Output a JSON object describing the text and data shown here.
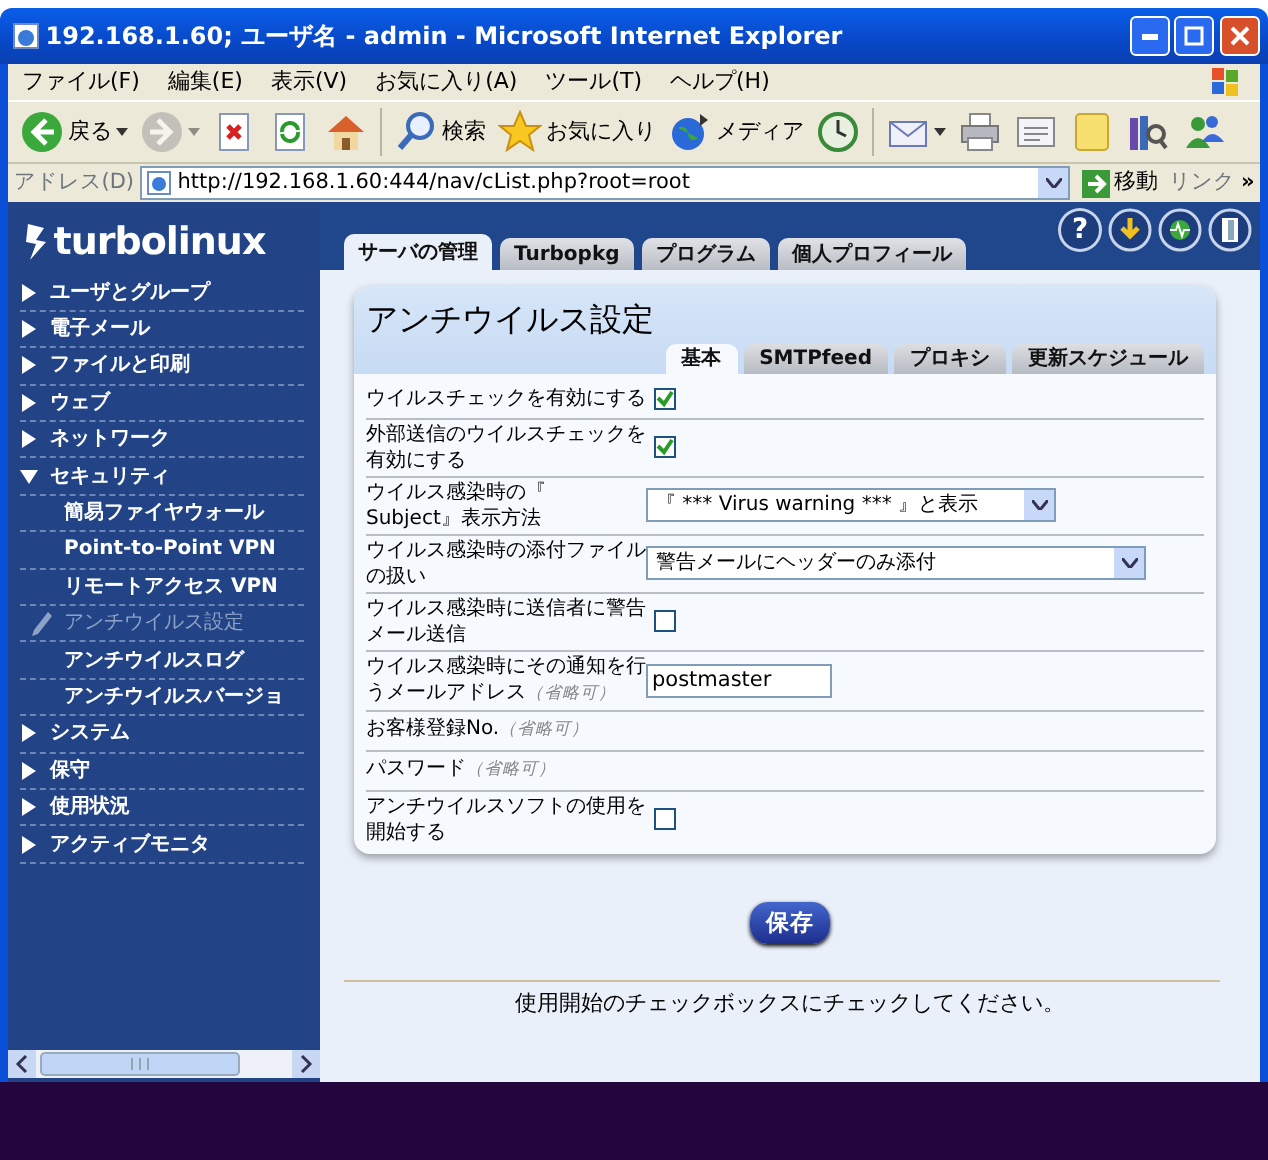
{
  "window": {
    "title": "192.168.1.60; ユーザ名 - admin - Microsoft Internet Explorer"
  },
  "menu_bar": [
    "ファイル(F)",
    "編集(E)",
    "表示(V)",
    "お気に入り(A)",
    "ツール(T)",
    "ヘルプ(H)"
  ],
  "toolbar": [
    {
      "kind": "back",
      "label": "戻る",
      "dropdown": true,
      "disabled": false
    },
    {
      "kind": "forward",
      "dropdown": true,
      "disabled": true
    },
    {
      "kind": "stop",
      "disabled": false
    },
    {
      "kind": "refresh",
      "disabled": false
    },
    {
      "kind": "home",
      "disabled": false
    },
    {
      "kind": "separator"
    },
    {
      "kind": "search",
      "label": "検索",
      "disabled": false
    },
    {
      "kind": "favorites",
      "label": "お気に入り",
      "disabled": false
    },
    {
      "kind": "media",
      "label": "メディア",
      "disabled": false
    },
    {
      "kind": "history",
      "disabled": false
    },
    {
      "kind": "separator"
    },
    {
      "kind": "mail",
      "dropdown": true,
      "disabled": false
    },
    {
      "kind": "print",
      "disabled": false
    },
    {
      "kind": "edit",
      "disabled": false
    },
    {
      "kind": "note",
      "disabled": false
    },
    {
      "kind": "research",
      "disabled": false
    },
    {
      "kind": "messenger",
      "disabled": false
    }
  ],
  "address_bar": {
    "label": "アドレス(D)",
    "url": "http://192.168.1.60:444/nav/cList.php?root=root",
    "go": "移動",
    "links": "リンク",
    "more": "»"
  },
  "sidebar": {
    "logo": "turbolinux",
    "items": [
      {
        "label": "ユーザとグループ",
        "expanded": false
      },
      {
        "label": "電子メール",
        "expanded": false
      },
      {
        "label": "ファイルと印刷",
        "expanded": false
      },
      {
        "label": "ウェブ",
        "expanded": false
      },
      {
        "label": "ネットワーク",
        "expanded": false
      },
      {
        "label": "セキュリティ",
        "expanded": true,
        "children": [
          {
            "label": "簡易ファイヤウォール",
            "selected": false
          },
          {
            "label": "Point-to-Point VPN",
            "selected": false
          },
          {
            "label": "リモートアクセス VPN",
            "selected": false
          },
          {
            "label": "アンチウイルス設定",
            "selected": true
          },
          {
            "label": "アンチウイルスログ",
            "selected": false
          },
          {
            "label": "アンチウイルスバージョ",
            "selected": false
          }
        ]
      },
      {
        "label": "システム",
        "expanded": false
      },
      {
        "label": "保守",
        "expanded": false
      },
      {
        "label": "使用状況",
        "expanded": false
      },
      {
        "label": "アクティブモニタ",
        "expanded": false
      }
    ]
  },
  "top_tabs": [
    {
      "label": "サーバの管理",
      "selected": true
    },
    {
      "label": "Turbopkg",
      "selected": false
    },
    {
      "label": "プログラム",
      "selected": false
    },
    {
      "label": "個人プロフィール",
      "selected": false
    }
  ],
  "top_icons": [
    {
      "kind": "help",
      "glyph": "?"
    },
    {
      "kind": "download"
    },
    {
      "kind": "monitor"
    },
    {
      "kind": "logout"
    }
  ],
  "panel": {
    "title": "アンチウイルス設定",
    "tabs": [
      {
        "label": "基本",
        "selected": true
      },
      {
        "label": "SMTPfeed",
        "selected": false
      },
      {
        "label": "プロキシ",
        "selected": false
      },
      {
        "label": "更新スケジュール",
        "selected": false
      }
    ],
    "rows": [
      {
        "kind": "checkbox",
        "label": "ウイルスチェックを有効にする",
        "checked": true
      },
      {
        "kind": "checkbox",
        "label": "外部送信のウイルスチェックを有効にする",
        "checked": true
      },
      {
        "kind": "select",
        "label": "ウイルス感染時の『 Subject』表示方法",
        "value": "『 *** Virus warning *** 』と表示",
        "wide": false
      },
      {
        "kind": "select",
        "label": "ウイルス感染時の添付ファイルの扱い",
        "value": "警告メールにヘッダーのみ添付",
        "wide": true
      },
      {
        "kind": "checkbox",
        "label": "ウイルス感染時に送信者に警告メール送信",
        "checked": false
      },
      {
        "kind": "text",
        "label": "ウイルス感染時にその通知を行うメールアドレス",
        "hint": "（省略可）",
        "value": "postmaster"
      },
      {
        "kind": "plain",
        "label": "お客様登録No.",
        "hint": "（省略可）"
      },
      {
        "kind": "plain",
        "label": "パスワード",
        "hint": "（省略可）"
      },
      {
        "kind": "checkbox",
        "label": "アンチウイルスソフトの使用を開始する",
        "checked": false
      }
    ]
  },
  "save_button": "保存",
  "message": "使用開始のチェックボックスにチェックしてください。"
}
